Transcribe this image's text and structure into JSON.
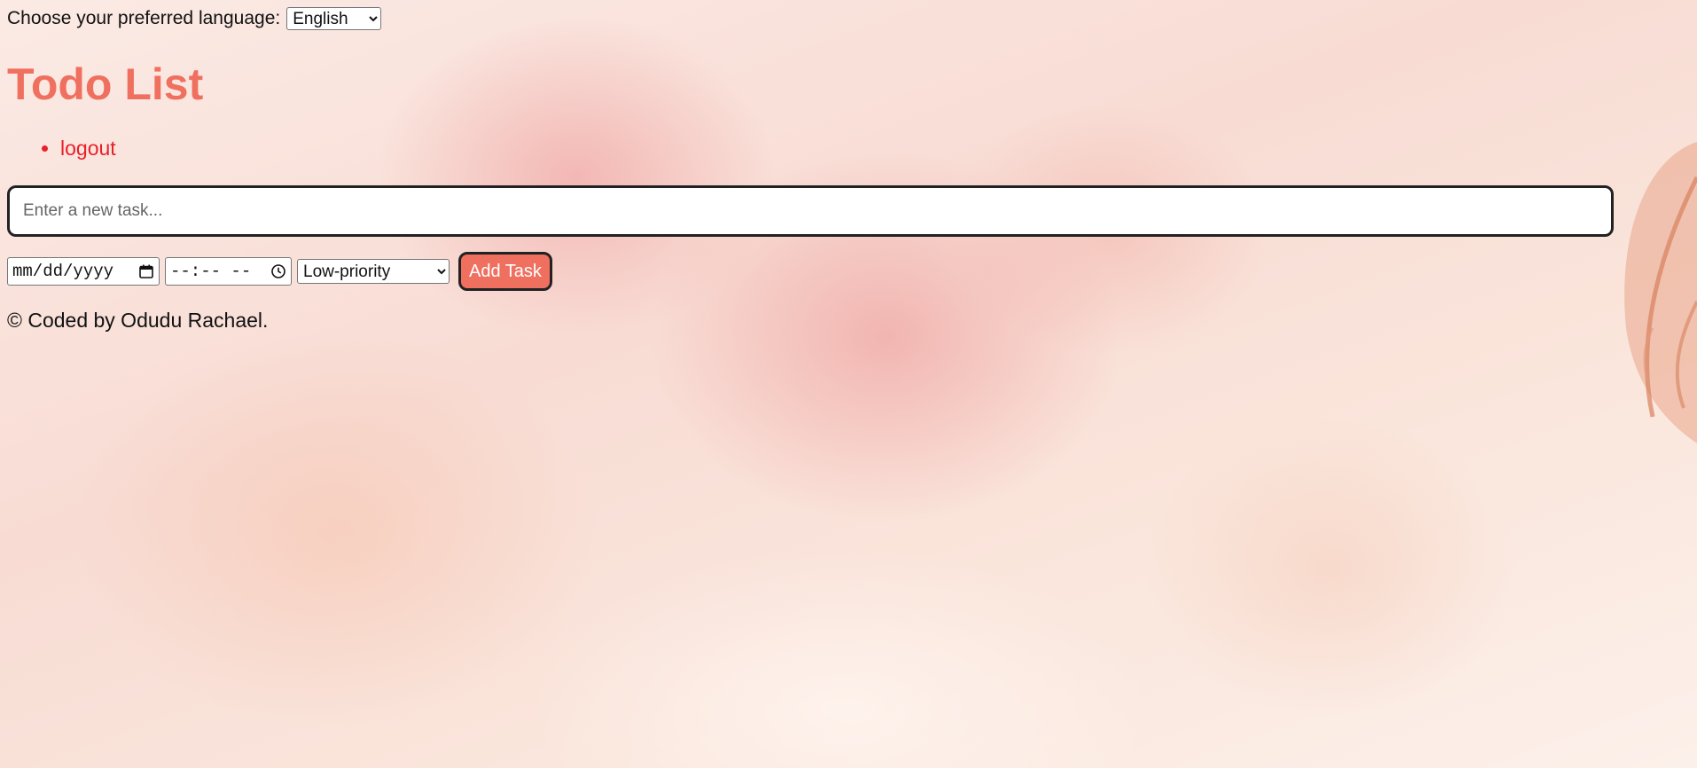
{
  "language": {
    "label": "Choose your preferred language:",
    "selected": "English"
  },
  "page": {
    "title": "Todo List"
  },
  "nav": {
    "logout_label": "logout"
  },
  "task_form": {
    "task_placeholder": "Enter a new task...",
    "date_placeholder": "mm/dd/yyyy",
    "time_placeholder": "--:-- --",
    "priority_selected": "Low-priority",
    "add_label": "Add Task"
  },
  "footer": {
    "text": "© Coded by Odudu Rachael."
  },
  "icons": {
    "date": "calendar-icon",
    "time": "clock-icon"
  },
  "colors": {
    "accent": "#f07060",
    "link": "#e8202a",
    "background": "#fbe8df"
  }
}
